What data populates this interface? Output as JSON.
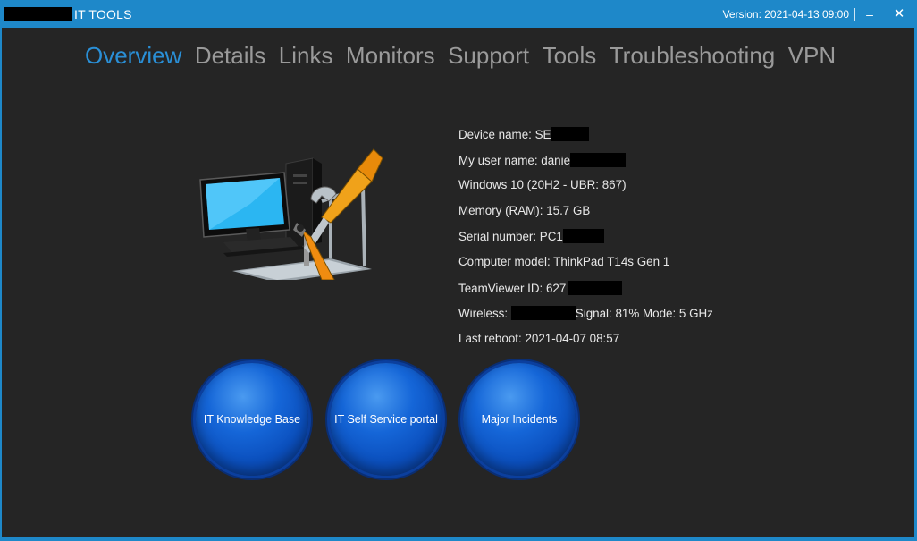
{
  "window": {
    "title": "IT TOOLS",
    "version": "Version: 2021-04-13 09:00",
    "minimize_glyph": "–",
    "close_glyph": "✕"
  },
  "tabs": [
    {
      "label": "Overview",
      "active": true
    },
    {
      "label": "Details"
    },
    {
      "label": "Links"
    },
    {
      "label": "Monitors"
    },
    {
      "label": "Support"
    },
    {
      "label": "Tools"
    },
    {
      "label": "Troubleshooting"
    },
    {
      "label": "VPN"
    }
  ],
  "info": {
    "device_prefix": "Device name: SE",
    "user_prefix": "My user name: danie",
    "os": "Windows 10 (20H2 - UBR: 867)",
    "memory": "Memory (RAM): 15.7 GB",
    "serial_prefix": "Serial number: PC1",
    "model": "Computer model: ThinkPad T14s Gen 1",
    "teamviewer_prefix": "TeamViewer ID: 627",
    "wireless_prefix": "Wireless: ",
    "wireless_suffix": "Signal: 81% Mode: 5 GHz",
    "last_reboot": "Last reboot: 2021-04-07 08:57"
  },
  "buttons": {
    "kb": "IT Knowledge Base",
    "portal": "IT Self Service portal",
    "incidents": "Major Incidents"
  },
  "colors": {
    "titlebar": "#1e88c9",
    "background": "#252525",
    "tab_active": "#2a8fd6",
    "tab_inactive": "#9a9a9a",
    "button_blue": "#1566d8"
  },
  "hero_image": "computer-with-tools-icon"
}
